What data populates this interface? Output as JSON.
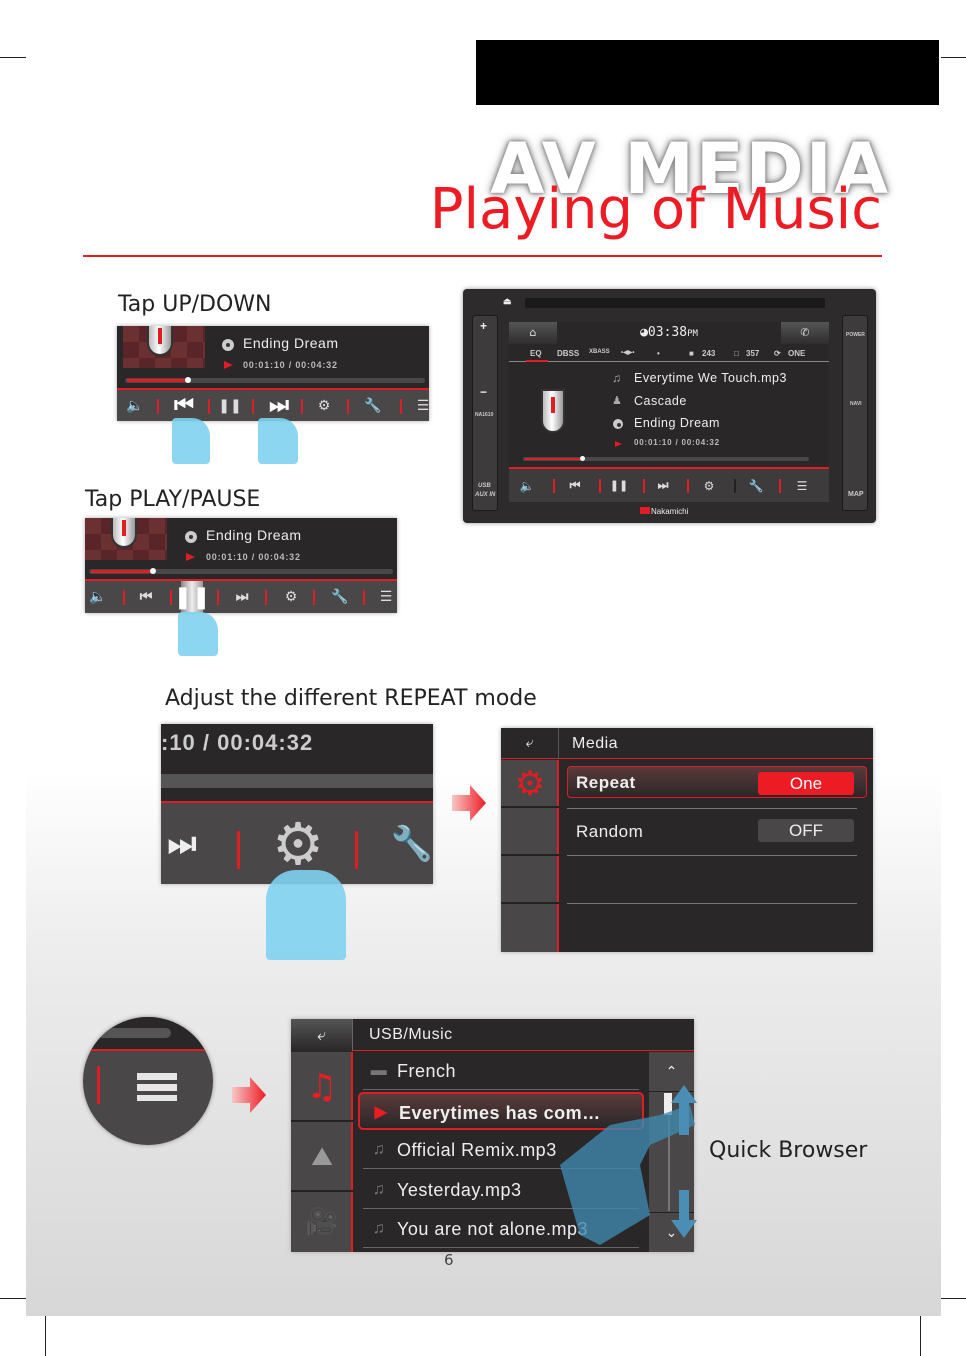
{
  "page": {
    "section_label": "AV MEDIA",
    "title": "Playing of Music",
    "page_number": "6",
    "accent_color": "#ed1c24"
  },
  "steps": {
    "up_down": "Tap UP/DOWN",
    "play_pause": "Tap PLAY/PAUSE",
    "repeat": "Adjust the different REPEAT mode",
    "quick_browser": "Quick Browser"
  },
  "player": {
    "title": "Everytime We Touch.mp3",
    "artist": "Cascade",
    "album": "Ending Dream",
    "time": "00:01:10 / 00:04:32",
    "time_zoomed": ":10 / 00:04:32",
    "progress_fraction": 0.2,
    "controls": [
      "volume",
      "previous",
      "pause",
      "next",
      "settings",
      "tools",
      "list"
    ]
  },
  "head_unit": {
    "clock_time": "03:38",
    "clock_ampm": "PM",
    "status": {
      "eq": "EQ",
      "dbss": "DBSS",
      "xbass": "XBASS",
      "balance": "•◀▶•",
      "light": "•",
      "folders": "243",
      "files": "357",
      "repeat": "ONE"
    },
    "left_buttons": {
      "plus": "+",
      "minus": "−",
      "model": "NA1610",
      "usb": "USB",
      "aux": "AUX IN"
    },
    "right_buttons": {
      "power": "POWER",
      "navi": "NAVI",
      "map": "MAP"
    },
    "brand": "Nakamichi"
  },
  "settings_panel": {
    "header": "Media",
    "rows": [
      {
        "label": "Repeat",
        "value": "One",
        "selected": true
      },
      {
        "label": "Random",
        "value": "OFF",
        "selected": false
      }
    ]
  },
  "browser": {
    "header": "USB/Music",
    "items": [
      {
        "type": "folder",
        "label": "French"
      },
      {
        "type": "playing",
        "label": "Everytimes has com…"
      },
      {
        "type": "song",
        "label": "Official Remix.mp3"
      },
      {
        "type": "song",
        "label": "Yesterday.mp3"
      },
      {
        "type": "song",
        "label": "You are not alone.mp3"
      }
    ],
    "tabs": [
      "music",
      "photo",
      "video"
    ]
  }
}
